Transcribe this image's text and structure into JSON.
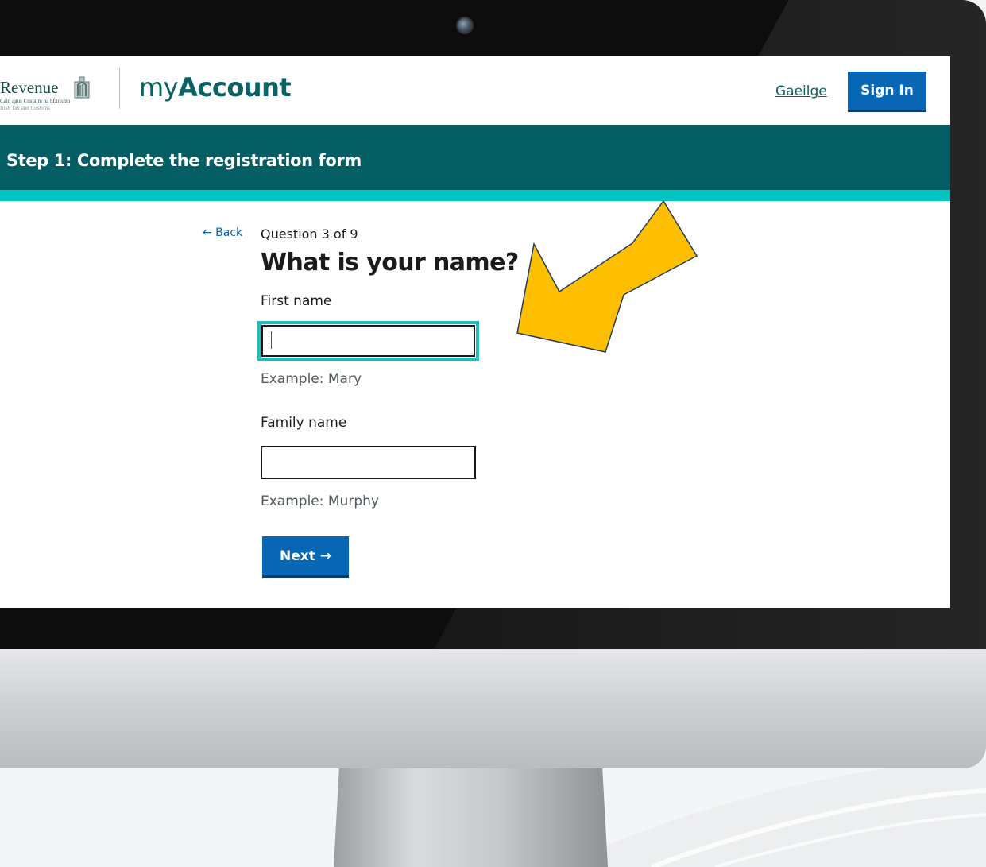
{
  "header": {
    "logo_wordmark": "Revenue",
    "logo_subtitle_1": "Cáin agus Custaim na hÉireann",
    "logo_subtitle_2": "Irish Tax and Customs",
    "app_title_prefix": "my",
    "app_title_main": "Account",
    "language_link": "Gaeilge",
    "sign_in_label": "Sign In"
  },
  "banner": {
    "step_title": "Step 1: Complete the registration form"
  },
  "form": {
    "back_label": "← Back",
    "progress": "Question 3 of 9",
    "question": "What is your name?",
    "first_name_label": "First name",
    "first_name_value": "",
    "first_name_hint": "Example: Mary",
    "family_name_label": "Family name",
    "family_name_value": "",
    "family_name_hint": "Example: Murphy",
    "next_label": "Next →"
  },
  "colors": {
    "brand_teal": "#055e63",
    "accent_cyan": "#00c6c2",
    "primary_blue": "#0767b4",
    "focus_ring": "#1fbcc0",
    "annotation_arrow": "#fdbf00"
  },
  "icons": {
    "header_logo": "harp-icon",
    "camera": "camera-icon",
    "annotation": "pointer-arrow-icon"
  }
}
